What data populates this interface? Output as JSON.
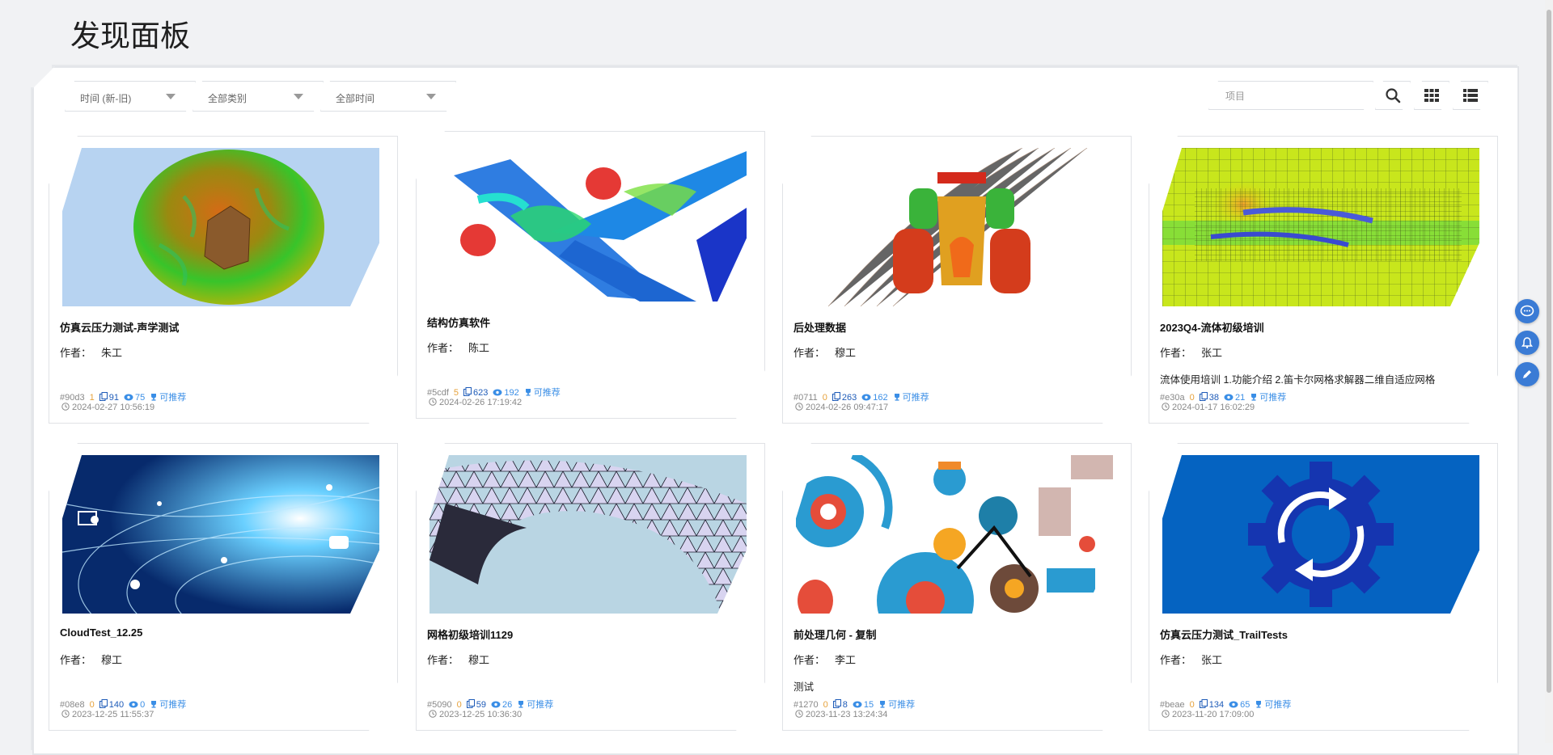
{
  "page": {
    "title": "发现面板"
  },
  "filters": {
    "sort": "时间 (新-旧)",
    "category": "全部类别",
    "time": "全部时间"
  },
  "search": {
    "placeholder": "项目"
  },
  "colors": {
    "accent": "#3a7bd5",
    "recommend": "#3a8ee6",
    "orange": "#e6a23c"
  },
  "cards": [
    {
      "title": "仿真云压力测试-声学测试",
      "author_label": "作者：",
      "author": "朱工",
      "desc": "",
      "id": "#90d3",
      "n1": "1",
      "n2": "91",
      "n3": "75",
      "rec": "可推荐",
      "date": "2024-02-27 10:56:19",
      "thumb": "acoustic-dome"
    },
    {
      "title": "结构仿真软件",
      "author_label": "作者：",
      "author": "陈工",
      "desc": "",
      "id": "#5cdf",
      "n1": "5",
      "n2": "623",
      "n3": "192",
      "rec": "可推荐",
      "date": "2024-02-26 17:19:42",
      "thumb": "airplane"
    },
    {
      "title": "后处理数据",
      "author_label": "作者：",
      "author": "穆工",
      "desc": "",
      "id": "#0711",
      "n1": "0",
      "n2": "263",
      "n3": "162",
      "rec": "可推荐",
      "date": "2024-02-26 09:47:17",
      "thumb": "race-car"
    },
    {
      "title": "2023Q4-流体初级培训",
      "author_label": "作者：",
      "author": "张工",
      "desc": "流体使用培训 1.功能介绍 2.笛卡尔网格求解器二维自适应网格",
      "id": "#e30a",
      "n1": "0",
      "n2": "38",
      "n3": "21",
      "rec": "可推荐",
      "date": "2024-01-17 16:02:29",
      "thumb": "fluid-mesh"
    },
    {
      "title": "CloudTest_12.25",
      "author_label": "作者：",
      "author": "穆工",
      "desc": "",
      "id": "#08e8",
      "n1": "0",
      "n2": "140",
      "n3": "0",
      "rec": "可推荐",
      "date": "2023-12-25 11:55:37",
      "thumb": "network-globe"
    },
    {
      "title": "网格初级培训1129",
      "author_label": "作者：",
      "author": "穆工",
      "desc": "",
      "id": "#5090",
      "n1": "0",
      "n2": "59",
      "n3": "26",
      "rec": "可推荐",
      "date": "2023-12-25 10:36:30",
      "thumb": "mesh-torus"
    },
    {
      "title": "前处理几何 - 复制",
      "author_label": "作者：",
      "author": "李工",
      "desc": "测试",
      "id": "#1270",
      "n1": "0",
      "n2": "8",
      "n3": "15",
      "rec": "可推荐",
      "date": "2023-11-23 13:24:34",
      "thumb": "gears"
    },
    {
      "title": "仿真云压力测试_TrailTests",
      "author_label": "作者：",
      "author": "张工",
      "desc": "",
      "id": "#beae",
      "n1": "0",
      "n2": "134",
      "n3": "65",
      "rec": "可推荐",
      "date": "2023-11-20 17:09:00",
      "thumb": "gear-refresh"
    }
  ],
  "side_buttons": [
    "chat-icon",
    "bell-icon",
    "pencil-icon"
  ]
}
